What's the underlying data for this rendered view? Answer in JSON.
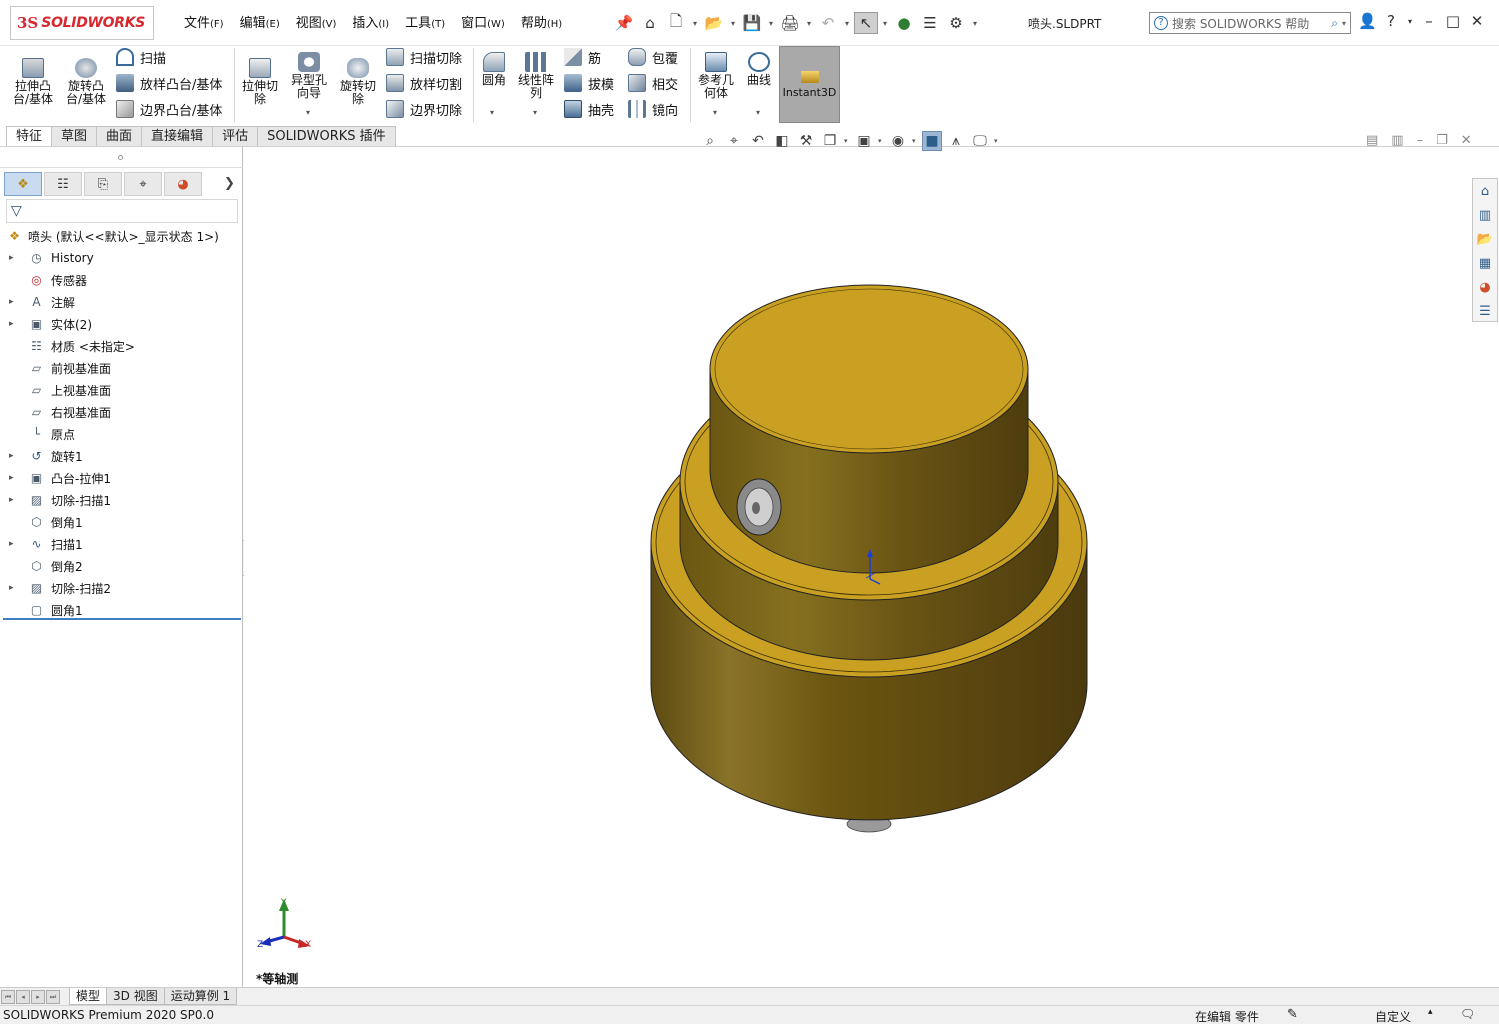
{
  "app": {
    "brand_ds": "3S",
    "brand_name": "SOLIDWORKS"
  },
  "menu": [
    {
      "label": "文件",
      "key": "(F)"
    },
    {
      "label": "编辑",
      "key": "(E)"
    },
    {
      "label": "视图",
      "key": "(V)"
    },
    {
      "label": "插入",
      "key": "(I)"
    },
    {
      "label": "工具",
      "key": "(T)"
    },
    {
      "label": "窗口",
      "key": "(W)"
    },
    {
      "label": "帮助",
      "key": "(H)"
    }
  ],
  "document": {
    "title": "喷头.SLDPRT"
  },
  "help_search": {
    "placeholder": "搜索 SOLIDWORKS 帮助"
  },
  "commands": {
    "extrude_boss": "拉伸凸\n台/基体",
    "revolve_boss": "旋转凸\n台/基体",
    "sweep": "扫描",
    "loft_boss": "放样凸台/基体",
    "boundary_boss": "边界凸台/基体",
    "extrude_cut": "拉伸切\n除",
    "hole_wizard": "异型孔\n向导",
    "revolve_cut": "旋转切\n除",
    "sweep_cut": "扫描切除",
    "loft_cut": "放样切割",
    "boundary_cut": "边界切除",
    "fillet": "圆角",
    "linear_pattern": "线性阵\n列",
    "rib": "筋",
    "draft": "拔模",
    "shell": "抽壳",
    "wrap": "包覆",
    "intersect": "相交",
    "mirror": "镜向",
    "ref_geometry": "参考几\n何体",
    "curves": "曲线",
    "instant3d": "Instant3D"
  },
  "tabs": [
    "特征",
    "草图",
    "曲面",
    "直接编辑",
    "评估",
    "SOLIDWORKS 插件"
  ],
  "tree": {
    "root": "喷头 (默认<<默认>_显示状态 1>)",
    "items": [
      {
        "label": "History",
        "expand": true,
        "icon": "history-icon"
      },
      {
        "label": "传感器",
        "expand": false,
        "icon": "sensor-icon"
      },
      {
        "label": "注解",
        "expand": true,
        "icon": "annotation-icon"
      },
      {
        "label": "实体(2)",
        "expand": true,
        "icon": "solid-bodies-icon"
      },
      {
        "label": "材质 <未指定>",
        "expand": false,
        "icon": "material-icon"
      },
      {
        "label": "前视基准面",
        "expand": false,
        "icon": "plane-icon"
      },
      {
        "label": "上视基准面",
        "expand": false,
        "icon": "plane-icon"
      },
      {
        "label": "右视基准面",
        "expand": false,
        "icon": "plane-icon"
      },
      {
        "label": "原点",
        "expand": false,
        "icon": "origin-icon"
      },
      {
        "label": "旋转1",
        "expand": true,
        "icon": "revolve-icon"
      },
      {
        "label": "凸台-拉伸1",
        "expand": true,
        "icon": "extrude-icon"
      },
      {
        "label": "切除-扫描1",
        "expand": true,
        "icon": "sweep-cut-icon"
      },
      {
        "label": "倒角1",
        "expand": false,
        "icon": "chamfer-icon"
      },
      {
        "label": "扫描1",
        "expand": true,
        "icon": "sweep-icon"
      },
      {
        "label": "倒角2",
        "expand": false,
        "icon": "chamfer-icon"
      },
      {
        "label": "切除-扫描2",
        "expand": true,
        "icon": "sweep-cut-icon"
      },
      {
        "label": "圆角1",
        "expand": false,
        "icon": "fillet-icon"
      }
    ]
  },
  "viewport": {
    "view_name": "*等轴测",
    "triad": {
      "x": "X",
      "y": "Y",
      "z": "Z"
    }
  },
  "bottom_tabs": [
    "模型",
    "3D 视图",
    "运动算例 1"
  ],
  "status": {
    "product": "SOLIDWORKS Premium 2020 SP0.0",
    "mode": "在编辑 零件",
    "units": "自定义"
  },
  "colors": {
    "part_gold": "#c9a021",
    "accent_blue": "#3d7fc1",
    "brand_red": "#d9272e"
  }
}
